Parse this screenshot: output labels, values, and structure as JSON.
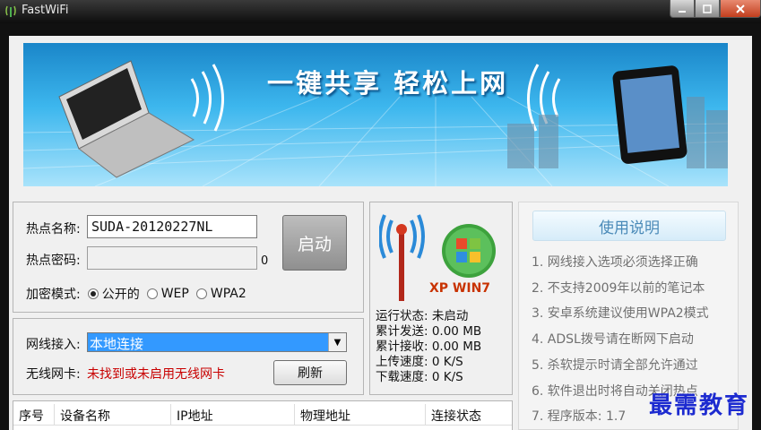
{
  "window": {
    "title": "FastWiFi"
  },
  "banner": {
    "slogan": "一键共享 轻松上网"
  },
  "hotspot": {
    "name_label": "热点名称:",
    "name_value": "SUDA-20120227NL",
    "password_label": "热点密码:",
    "password_value": "",
    "password_length": "0",
    "start_label": "启动",
    "encryption_label": "加密模式:",
    "encryption_options": [
      "公开的",
      "WEP",
      "WPA2"
    ],
    "encryption_selected": "公开的"
  },
  "network": {
    "wired_label": "网线接入:",
    "wired_value": "本地连接",
    "wireless_label": "无线网卡:",
    "wireless_status": "未找到或未启用无线网卡",
    "refresh_label": "刷新"
  },
  "table": {
    "columns": [
      "序号",
      "设备名称",
      "IP地址",
      "物理地址",
      "连接状态"
    ]
  },
  "status": {
    "logo_text": "XP WIN7",
    "lines": [
      "运行状态: 未启动",
      "累计发送: 0.00 MB",
      "累计接收: 0.00 MB",
      "上传速度: 0 K/S",
      "下载速度: 0 K/S"
    ]
  },
  "help": {
    "title": "使用说明",
    "items": [
      "1. 网线接入选项必须选择正确",
      "2. 不支持2009年以前的笔记本",
      "3. 安卓系统建议使用WPA2模式",
      "4. ADSL拨号请在断网下启动",
      "5. 杀软提示时请全部允许通过",
      "6. 软件退出时将自动关闭热点",
      "7. 程序版本: 1.7"
    ]
  },
  "watermark": "最需教育",
  "colors": {
    "banner_sky": "#3db7ee",
    "selected_blue": "#3399ff",
    "warning_red": "#c80000",
    "help_text": "#707070",
    "logo_red": "#c83200"
  }
}
